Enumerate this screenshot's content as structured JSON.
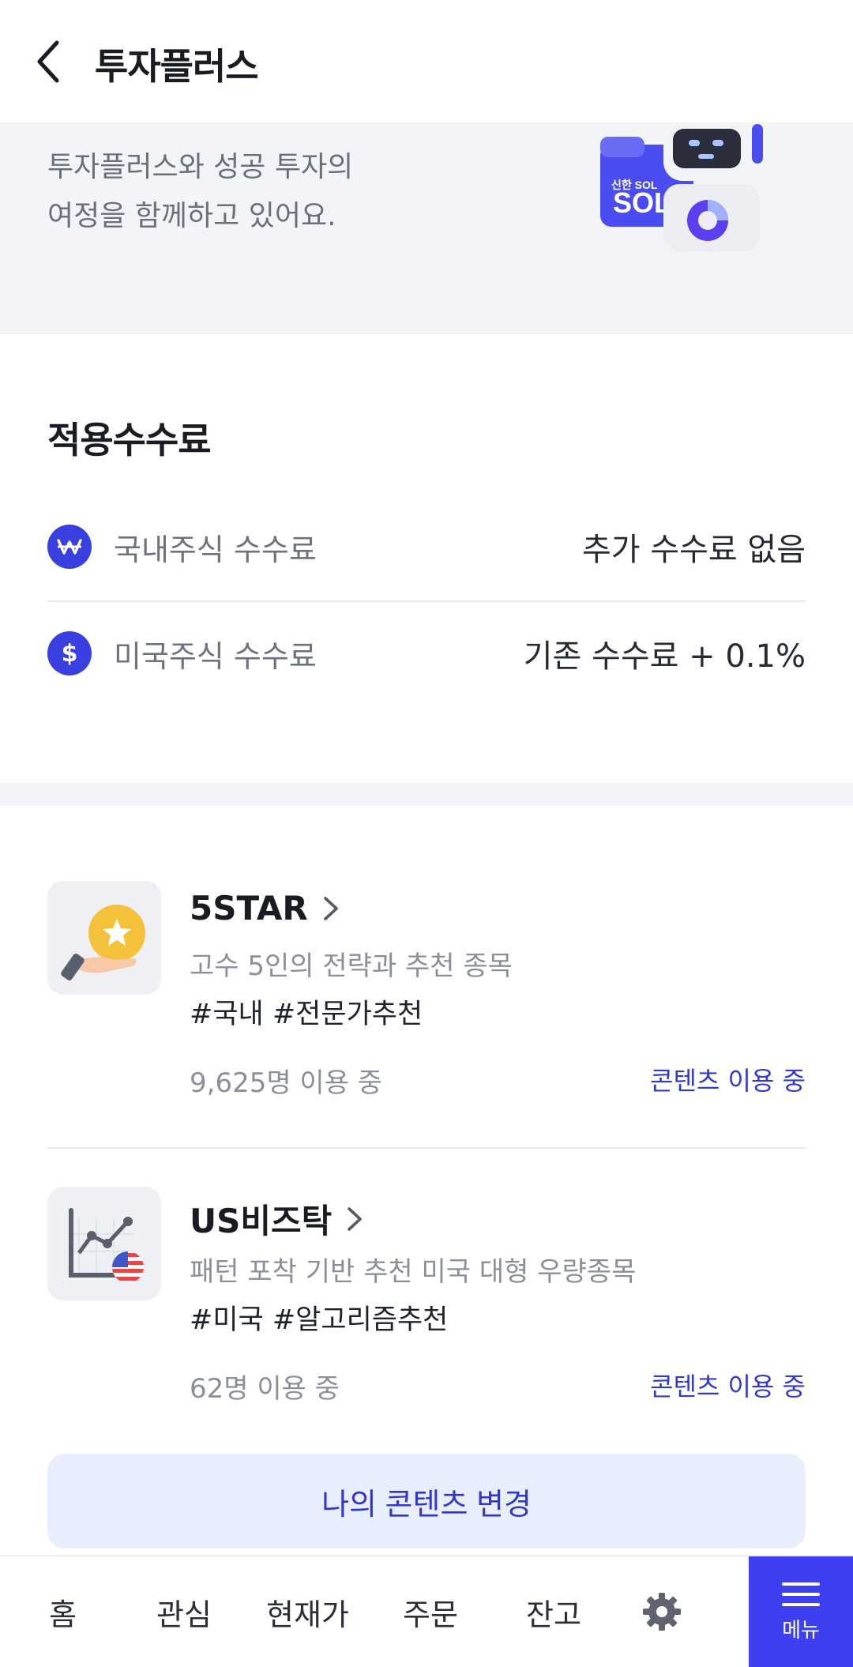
{
  "header": {
    "title": "투자플러스"
  },
  "banner": {
    "line1": "투자플러스와 성공 투자의",
    "line2": "여정을 함께하고 있어요.",
    "logo_text": "신한 SOL"
  },
  "fees": {
    "title": "적용수수료",
    "items": [
      {
        "icon": "won-icon",
        "symbol": "₩",
        "label": "국내주식 수수료",
        "value": "추가 수수료 없음"
      },
      {
        "icon": "dollar-icon",
        "symbol": "$",
        "label": "미국주식 수수료",
        "value": "기존 수수료 + 0.1%"
      }
    ]
  },
  "contents": [
    {
      "title": "5STAR",
      "desc": "고수 5인의 전략과 추천 종목",
      "tags": "#국내 #전문가추천",
      "users": "9,625명 이용 중",
      "status": "콘텐츠 이용 중",
      "icon": "star-coin-icon"
    },
    {
      "title": "US비즈탁",
      "desc": "패턴 포착 기반 추천 미국 대형 우량종목",
      "tags": "#미국 #알고리즘추천",
      "users": "62명 이용 중",
      "status": "콘텐츠 이용 중",
      "icon": "us-chart-icon"
    }
  ],
  "change_button": "나의 콘텐츠 변경",
  "nav": {
    "home": "홈",
    "watch": "관심",
    "price": "현재가",
    "order": "주문",
    "balance": "잔고",
    "settings_icon": "gear-icon",
    "menu": "메뉴"
  },
  "colors": {
    "accent": "#3d3ff0",
    "link": "#3338cf",
    "banner_bg": "#f3f4f7"
  }
}
